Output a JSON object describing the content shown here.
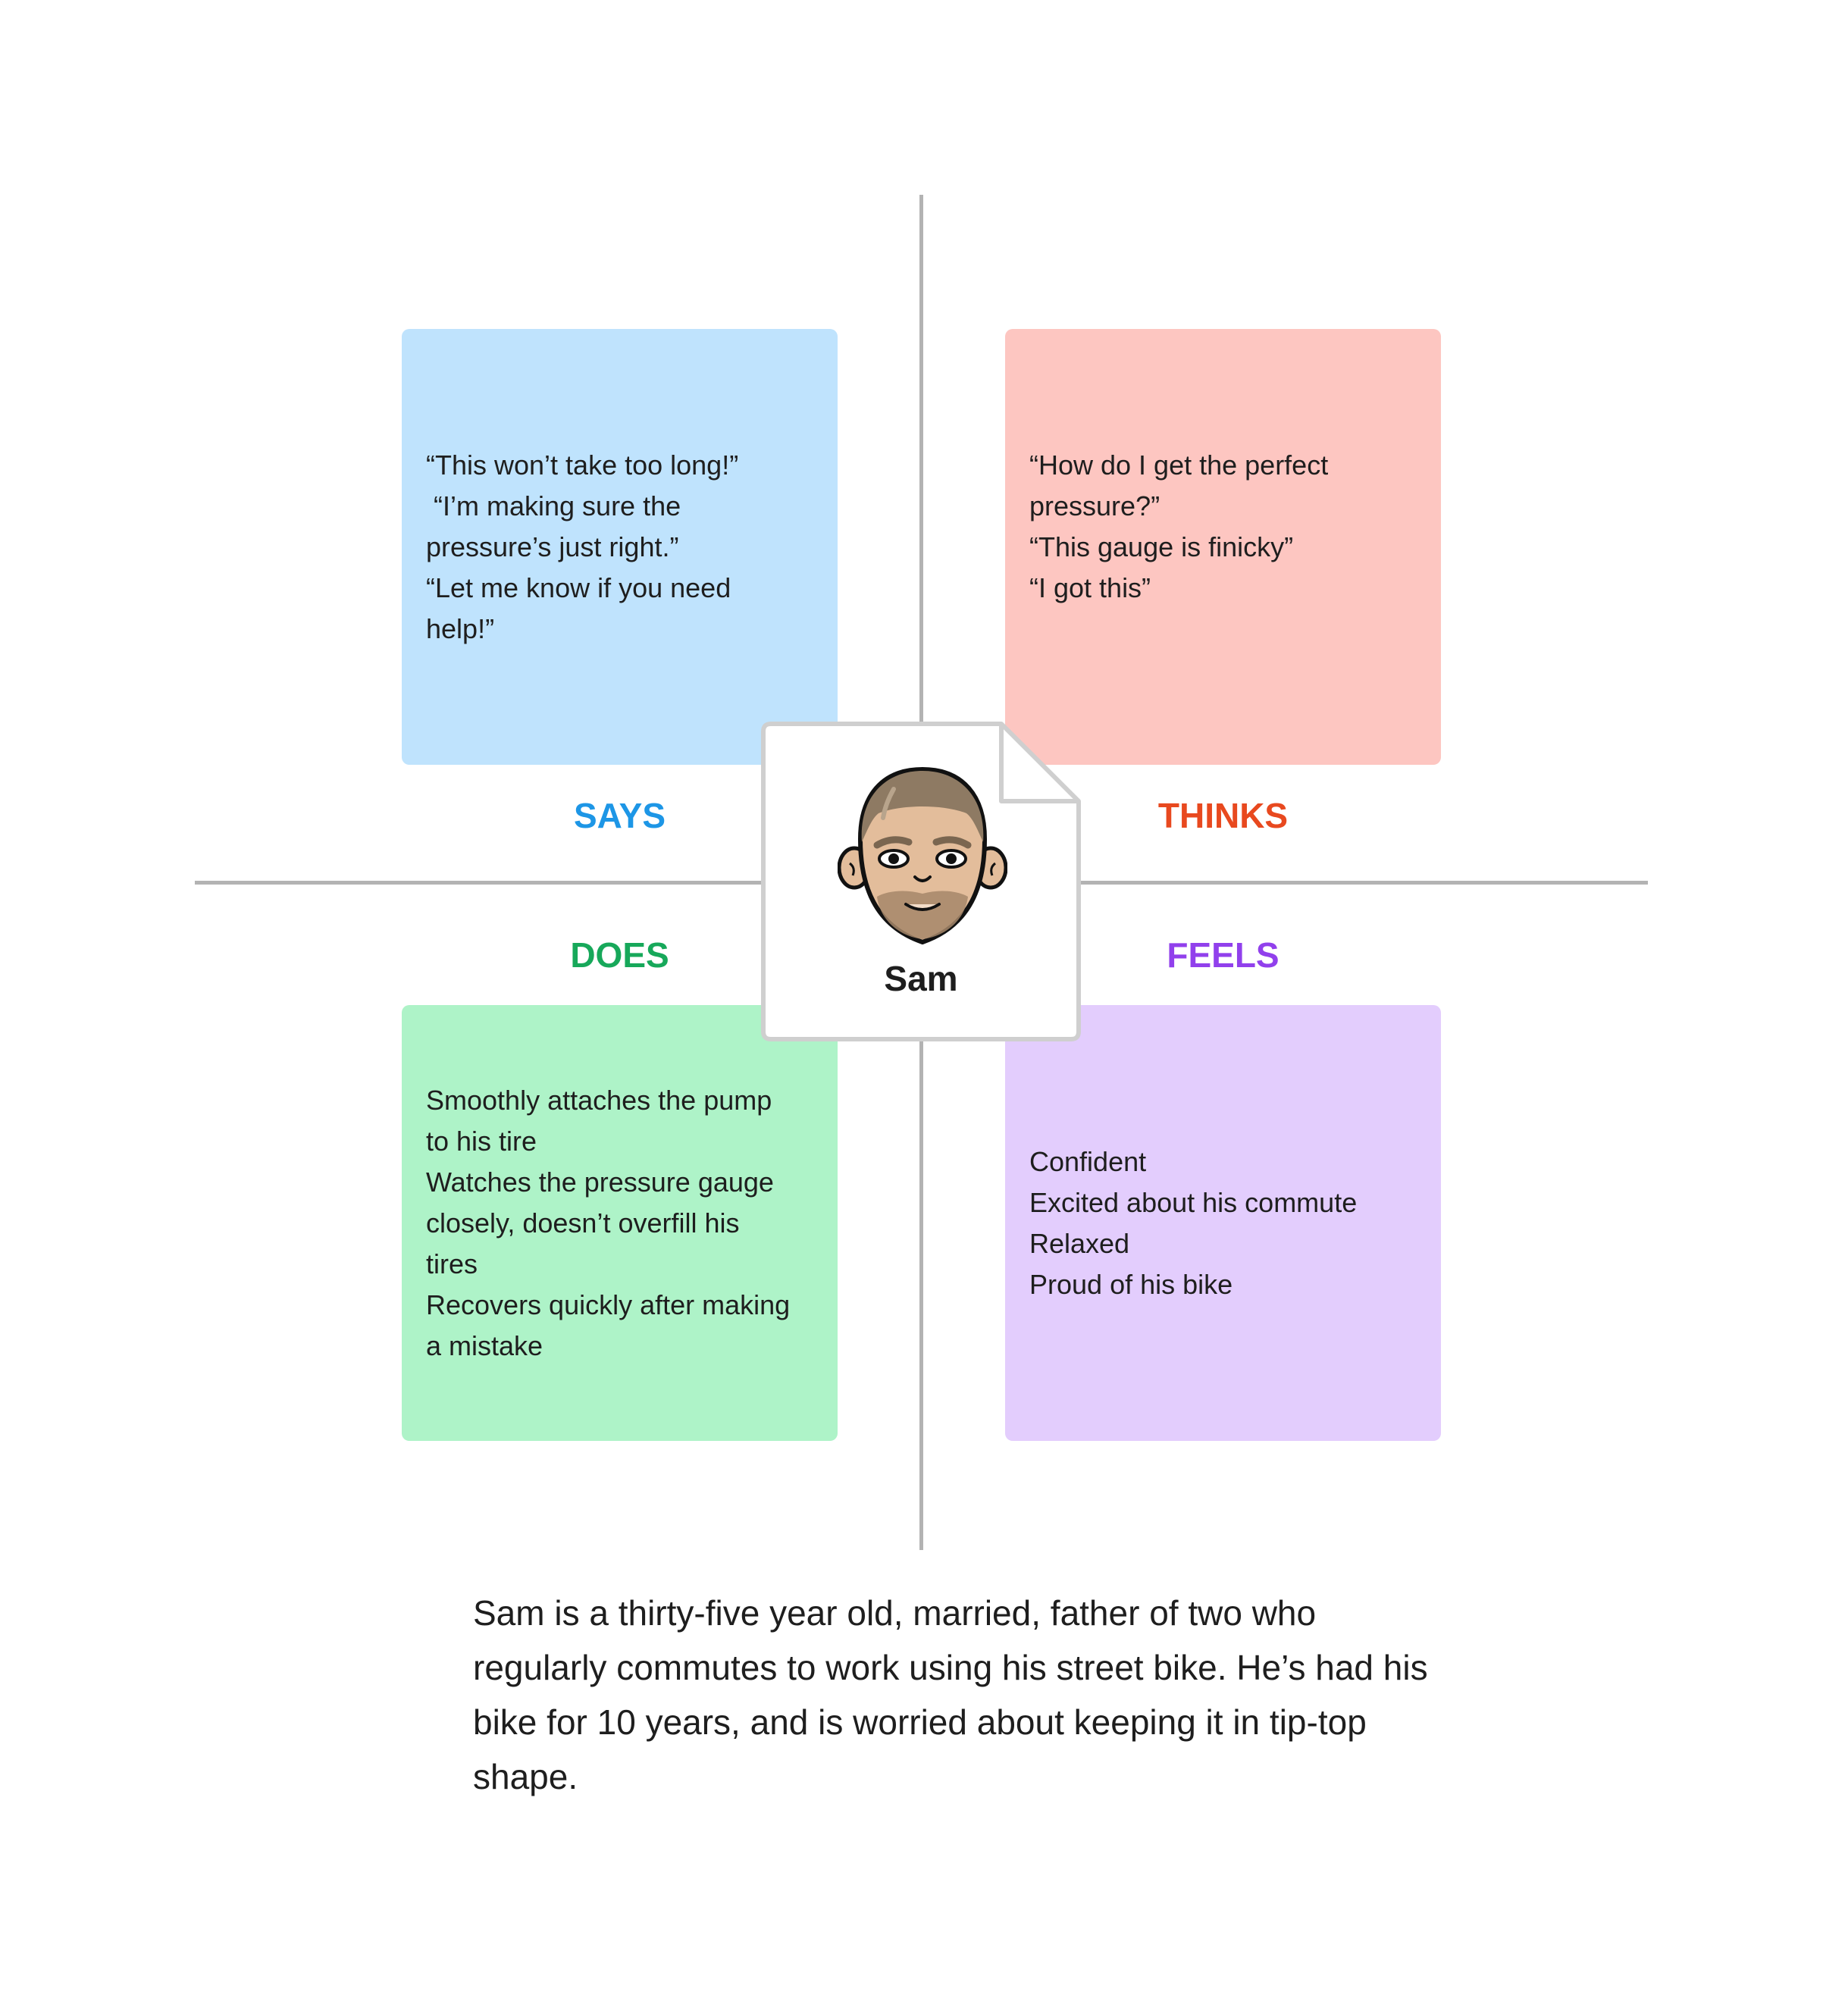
{
  "persona": {
    "name": "Sam",
    "summary": "Sam is a thirty-five year old, married, father of two who regularly commutes to work using his street bike. He’s had his bike for 10 years, and is worried about keeping it in tip-top shape."
  },
  "quadrants": {
    "says": {
      "label": "SAYS",
      "color": "#1d96e6",
      "note_color": "#bfe3fd",
      "lines": [
        "“This won’t take too long!”",
        " “I’m making sure the",
        "pressure’s just right.”",
        "“Let me know if you need",
        "help!”"
      ]
    },
    "thinks": {
      "label": "THINKS",
      "color": "#e8491f",
      "note_color": "#fdc6c1",
      "lines": [
        "“How do I get the perfect",
        "pressure?”",
        "“This gauge is finicky”",
        "“I got this”"
      ]
    },
    "does": {
      "label": "DOES",
      "color": "#17a85a",
      "note_color": "#aef3c8",
      "lines": [
        "Smoothly attaches the pump",
        "to his tire",
        "Watches the pressure gauge",
        "closely, doesn’t overfill his",
        "tires",
        "Recovers quickly after making",
        "a mistake"
      ]
    },
    "feels": {
      "label": "FEELS",
      "color": "#9140ec",
      "note_color": "#e3cdfd",
      "lines": [
        "Confident",
        "Excited about his commute",
        "Relaxed",
        "Proud of his bike"
      ]
    }
  },
  "icons": {
    "avatar": "male-avatar-icon"
  }
}
